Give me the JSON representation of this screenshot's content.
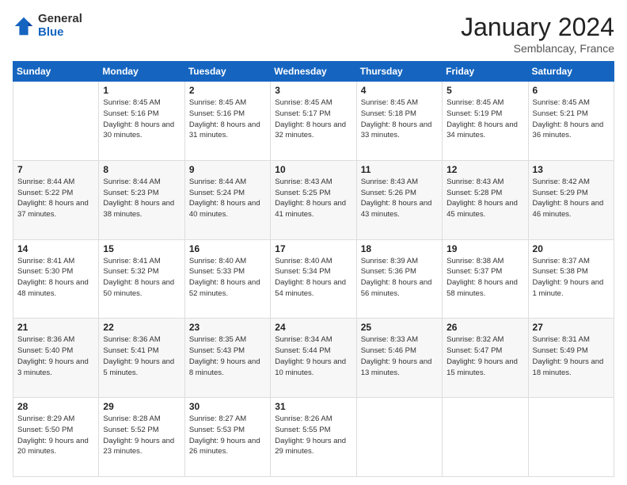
{
  "header": {
    "logo_general": "General",
    "logo_blue": "Blue",
    "month_title": "January 2024",
    "location": "Semblancay, France"
  },
  "days_of_week": [
    "Sunday",
    "Monday",
    "Tuesday",
    "Wednesday",
    "Thursday",
    "Friday",
    "Saturday"
  ],
  "weeks": [
    [
      {
        "day": "",
        "sunrise": "",
        "sunset": "",
        "daylight": ""
      },
      {
        "day": "1",
        "sunrise": "Sunrise: 8:45 AM",
        "sunset": "Sunset: 5:16 PM",
        "daylight": "Daylight: 8 hours and 30 minutes."
      },
      {
        "day": "2",
        "sunrise": "Sunrise: 8:45 AM",
        "sunset": "Sunset: 5:16 PM",
        "daylight": "Daylight: 8 hours and 31 minutes."
      },
      {
        "day": "3",
        "sunrise": "Sunrise: 8:45 AM",
        "sunset": "Sunset: 5:17 PM",
        "daylight": "Daylight: 8 hours and 32 minutes."
      },
      {
        "day": "4",
        "sunrise": "Sunrise: 8:45 AM",
        "sunset": "Sunset: 5:18 PM",
        "daylight": "Daylight: 8 hours and 33 minutes."
      },
      {
        "day": "5",
        "sunrise": "Sunrise: 8:45 AM",
        "sunset": "Sunset: 5:19 PM",
        "daylight": "Daylight: 8 hours and 34 minutes."
      },
      {
        "day": "6",
        "sunrise": "Sunrise: 8:45 AM",
        "sunset": "Sunset: 5:21 PM",
        "daylight": "Daylight: 8 hours and 36 minutes."
      }
    ],
    [
      {
        "day": "7",
        "sunrise": "Sunrise: 8:44 AM",
        "sunset": "Sunset: 5:22 PM",
        "daylight": "Daylight: 8 hours and 37 minutes."
      },
      {
        "day": "8",
        "sunrise": "Sunrise: 8:44 AM",
        "sunset": "Sunset: 5:23 PM",
        "daylight": "Daylight: 8 hours and 38 minutes."
      },
      {
        "day": "9",
        "sunrise": "Sunrise: 8:44 AM",
        "sunset": "Sunset: 5:24 PM",
        "daylight": "Daylight: 8 hours and 40 minutes."
      },
      {
        "day": "10",
        "sunrise": "Sunrise: 8:43 AM",
        "sunset": "Sunset: 5:25 PM",
        "daylight": "Daylight: 8 hours and 41 minutes."
      },
      {
        "day": "11",
        "sunrise": "Sunrise: 8:43 AM",
        "sunset": "Sunset: 5:26 PM",
        "daylight": "Daylight: 8 hours and 43 minutes."
      },
      {
        "day": "12",
        "sunrise": "Sunrise: 8:43 AM",
        "sunset": "Sunset: 5:28 PM",
        "daylight": "Daylight: 8 hours and 45 minutes."
      },
      {
        "day": "13",
        "sunrise": "Sunrise: 8:42 AM",
        "sunset": "Sunset: 5:29 PM",
        "daylight": "Daylight: 8 hours and 46 minutes."
      }
    ],
    [
      {
        "day": "14",
        "sunrise": "Sunrise: 8:41 AM",
        "sunset": "Sunset: 5:30 PM",
        "daylight": "Daylight: 8 hours and 48 minutes."
      },
      {
        "day": "15",
        "sunrise": "Sunrise: 8:41 AM",
        "sunset": "Sunset: 5:32 PM",
        "daylight": "Daylight: 8 hours and 50 minutes."
      },
      {
        "day": "16",
        "sunrise": "Sunrise: 8:40 AM",
        "sunset": "Sunset: 5:33 PM",
        "daylight": "Daylight: 8 hours and 52 minutes."
      },
      {
        "day": "17",
        "sunrise": "Sunrise: 8:40 AM",
        "sunset": "Sunset: 5:34 PM",
        "daylight": "Daylight: 8 hours and 54 minutes."
      },
      {
        "day": "18",
        "sunrise": "Sunrise: 8:39 AM",
        "sunset": "Sunset: 5:36 PM",
        "daylight": "Daylight: 8 hours and 56 minutes."
      },
      {
        "day": "19",
        "sunrise": "Sunrise: 8:38 AM",
        "sunset": "Sunset: 5:37 PM",
        "daylight": "Daylight: 8 hours and 58 minutes."
      },
      {
        "day": "20",
        "sunrise": "Sunrise: 8:37 AM",
        "sunset": "Sunset: 5:38 PM",
        "daylight": "Daylight: 9 hours and 1 minute."
      }
    ],
    [
      {
        "day": "21",
        "sunrise": "Sunrise: 8:36 AM",
        "sunset": "Sunset: 5:40 PM",
        "daylight": "Daylight: 9 hours and 3 minutes."
      },
      {
        "day": "22",
        "sunrise": "Sunrise: 8:36 AM",
        "sunset": "Sunset: 5:41 PM",
        "daylight": "Daylight: 9 hours and 5 minutes."
      },
      {
        "day": "23",
        "sunrise": "Sunrise: 8:35 AM",
        "sunset": "Sunset: 5:43 PM",
        "daylight": "Daylight: 9 hours and 8 minutes."
      },
      {
        "day": "24",
        "sunrise": "Sunrise: 8:34 AM",
        "sunset": "Sunset: 5:44 PM",
        "daylight": "Daylight: 9 hours and 10 minutes."
      },
      {
        "day": "25",
        "sunrise": "Sunrise: 8:33 AM",
        "sunset": "Sunset: 5:46 PM",
        "daylight": "Daylight: 9 hours and 13 minutes."
      },
      {
        "day": "26",
        "sunrise": "Sunrise: 8:32 AM",
        "sunset": "Sunset: 5:47 PM",
        "daylight": "Daylight: 9 hours and 15 minutes."
      },
      {
        "day": "27",
        "sunrise": "Sunrise: 8:31 AM",
        "sunset": "Sunset: 5:49 PM",
        "daylight": "Daylight: 9 hours and 18 minutes."
      }
    ],
    [
      {
        "day": "28",
        "sunrise": "Sunrise: 8:29 AM",
        "sunset": "Sunset: 5:50 PM",
        "daylight": "Daylight: 9 hours and 20 minutes."
      },
      {
        "day": "29",
        "sunrise": "Sunrise: 8:28 AM",
        "sunset": "Sunset: 5:52 PM",
        "daylight": "Daylight: 9 hours and 23 minutes."
      },
      {
        "day": "30",
        "sunrise": "Sunrise: 8:27 AM",
        "sunset": "Sunset: 5:53 PM",
        "daylight": "Daylight: 9 hours and 26 minutes."
      },
      {
        "day": "31",
        "sunrise": "Sunrise: 8:26 AM",
        "sunset": "Sunset: 5:55 PM",
        "daylight": "Daylight: 9 hours and 29 minutes."
      },
      {
        "day": "",
        "sunrise": "",
        "sunset": "",
        "daylight": ""
      },
      {
        "day": "",
        "sunrise": "",
        "sunset": "",
        "daylight": ""
      },
      {
        "day": "",
        "sunrise": "",
        "sunset": "",
        "daylight": ""
      }
    ]
  ]
}
